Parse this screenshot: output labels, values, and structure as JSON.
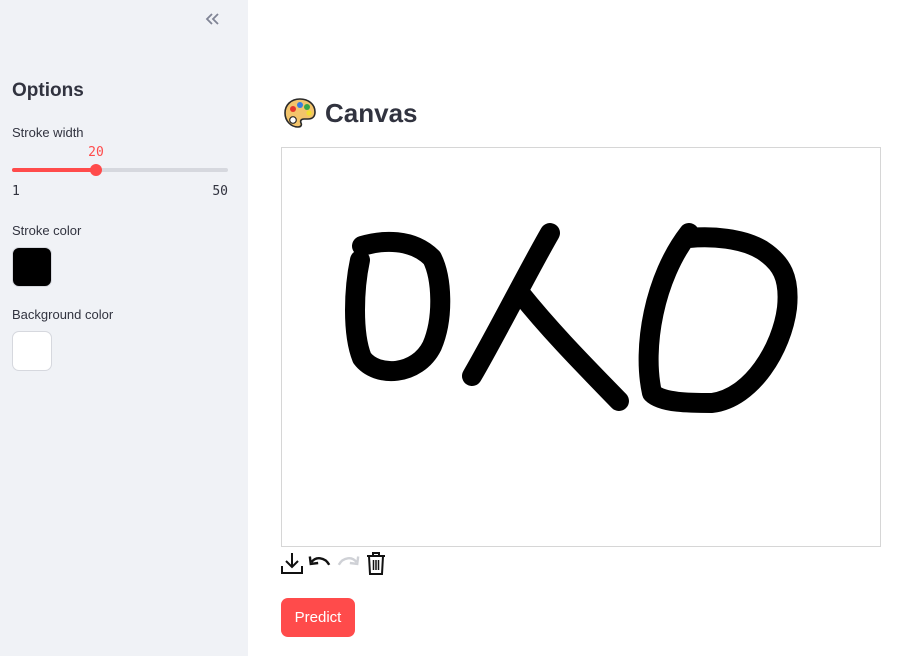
{
  "sidebar": {
    "title": "Options",
    "stroke_width": {
      "label": "Stroke width",
      "value": 20,
      "value_text": "20",
      "min": 1,
      "max": 50,
      "min_text": "1",
      "max_text": "50"
    },
    "stroke_color": {
      "label": "Stroke color",
      "value": "#000000"
    },
    "background_color": {
      "label": "Background color",
      "value": "#ffffff"
    }
  },
  "main": {
    "title_emoji_icon": "palette-icon",
    "title": "Canvas",
    "toolbar": {
      "icons": [
        "download-icon",
        "undo-icon",
        "redo-icon",
        "trash-icon"
      ]
    },
    "predict_label": "Predict"
  },
  "colors": {
    "accent": "#ff4b4b",
    "sidebar_bg": "#f0f2f6",
    "text": "#31333f"
  }
}
